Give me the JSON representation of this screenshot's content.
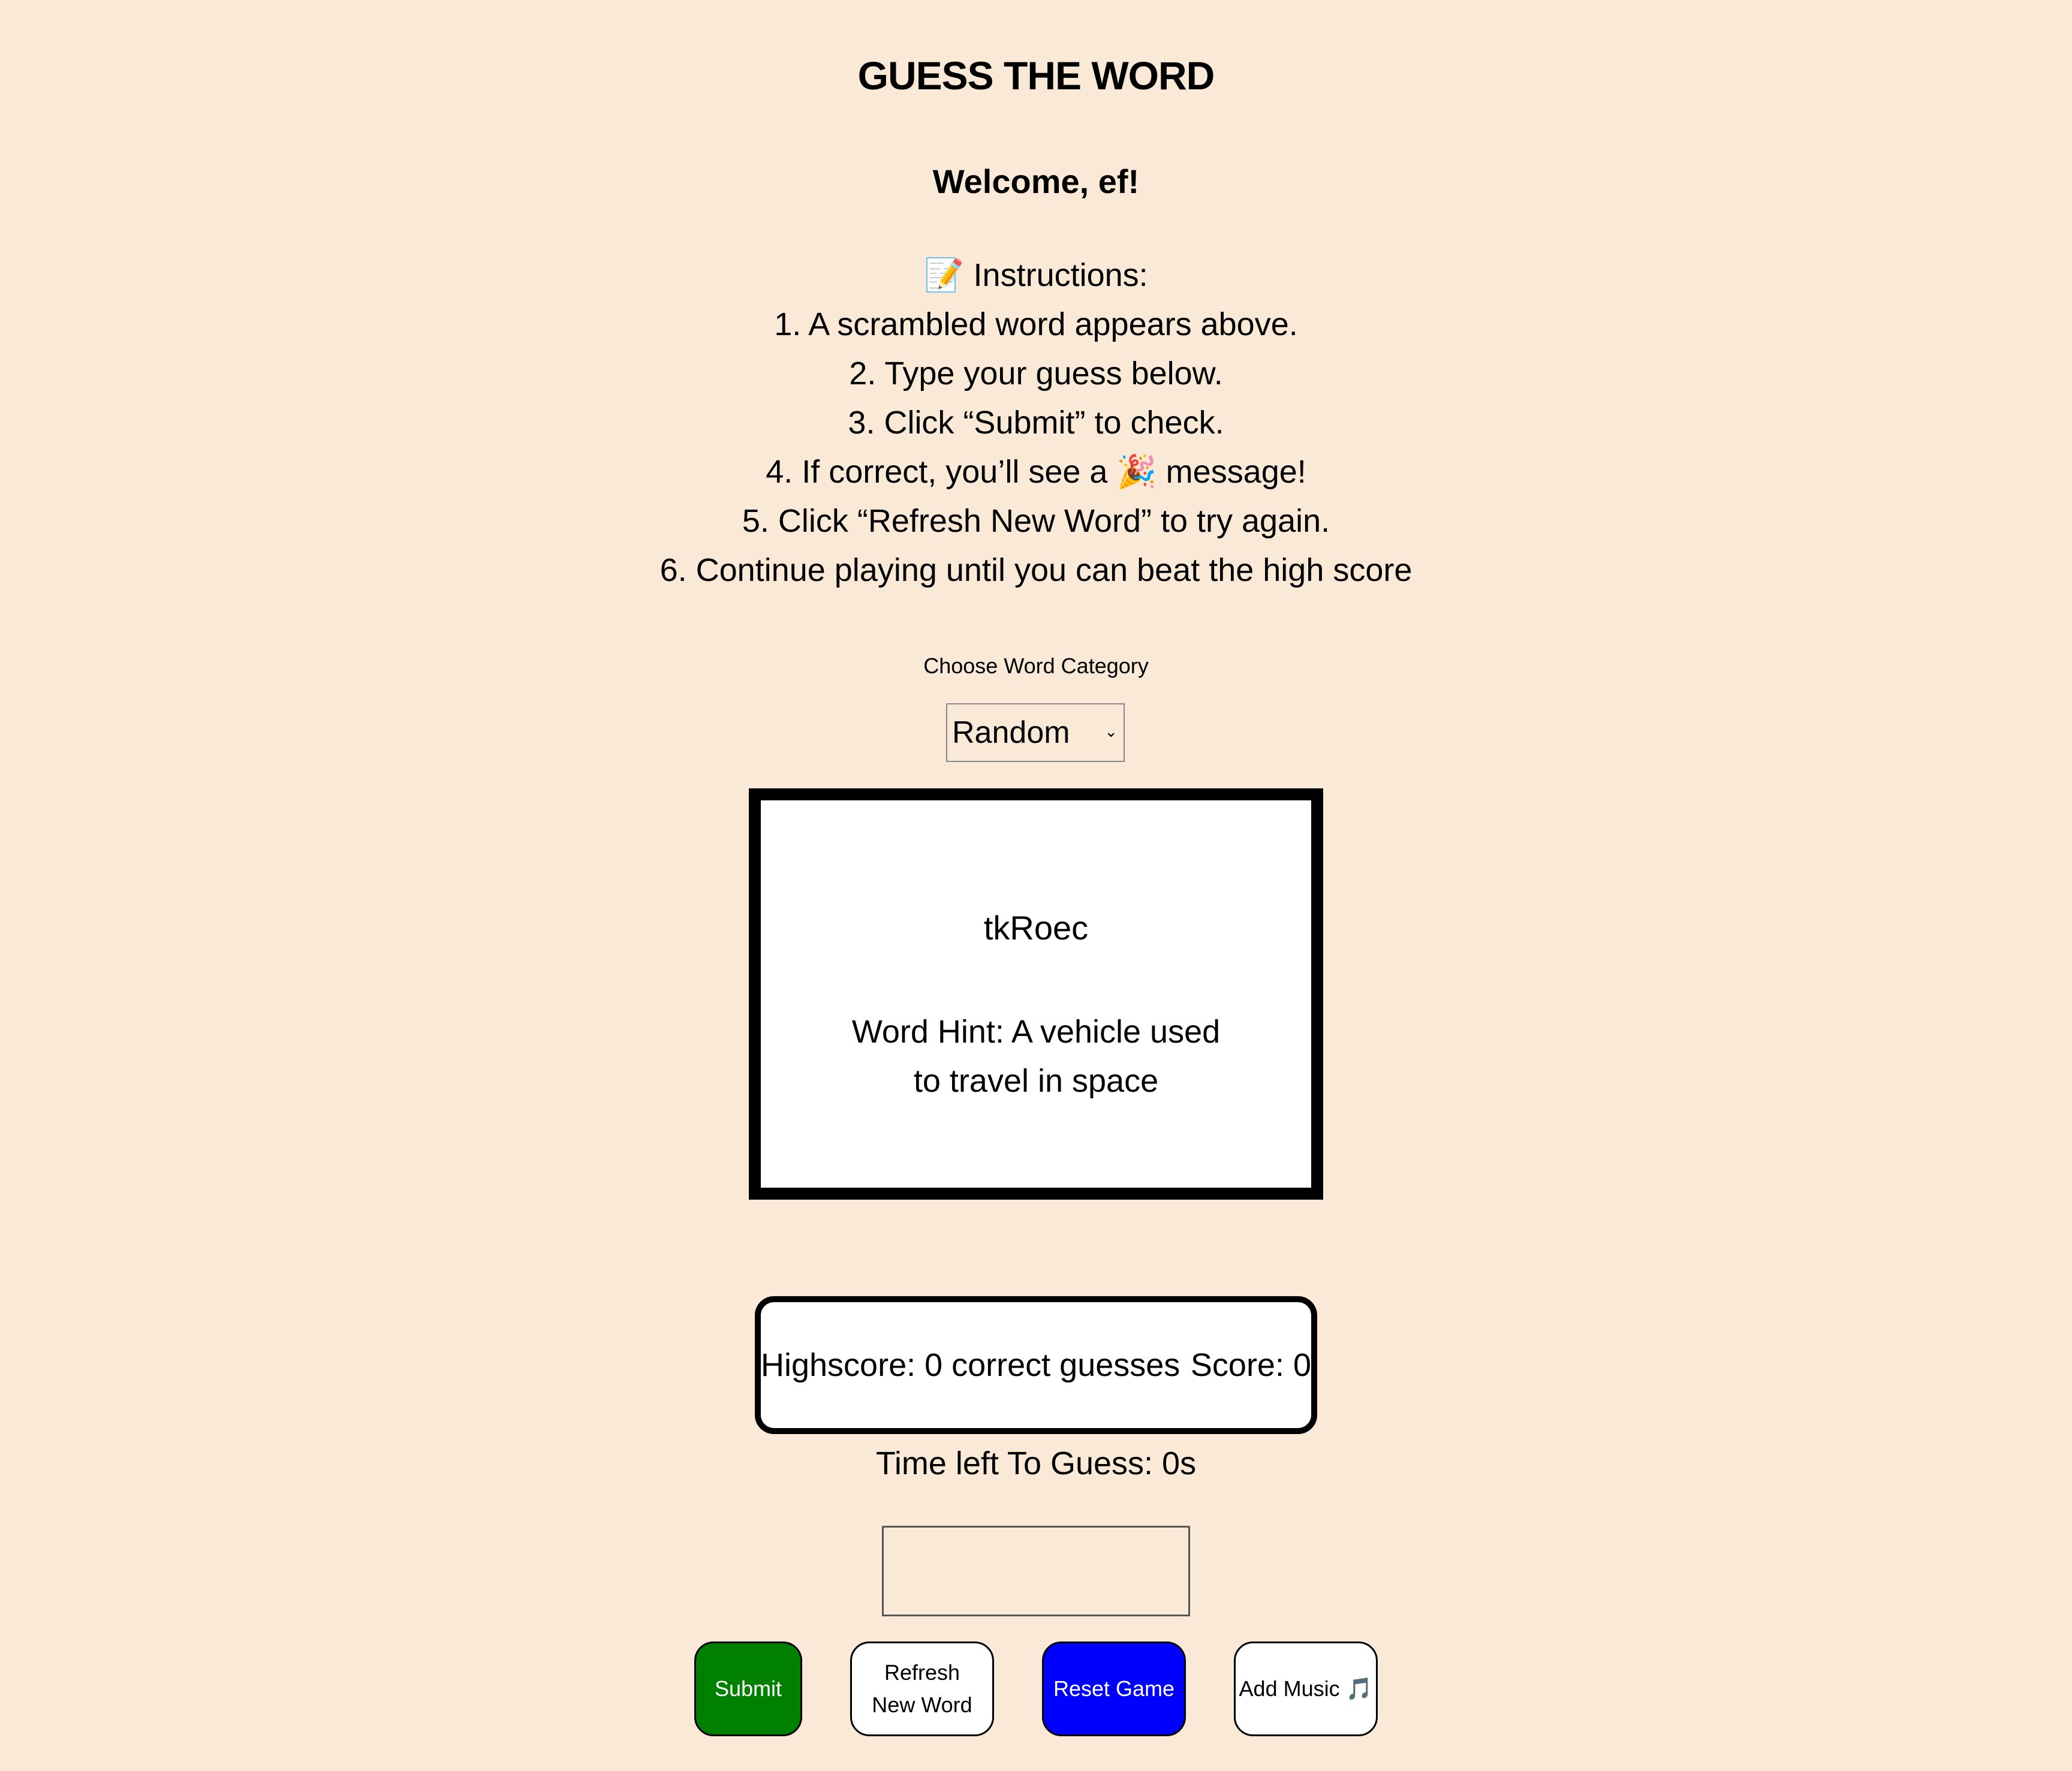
{
  "header": {
    "title": "GUESS THE WORD",
    "welcome": "Welcome, ef!"
  },
  "instructions": {
    "heading": "📝 Instructions:",
    "steps": [
      "1. A scrambled word appears above.",
      "2. Type your guess below.",
      "3. Click “Submit” to check.",
      "4. If correct, you’ll see a 🎉 message!",
      "5. Click “Refresh New Word” to try again.",
      "6. Continue playing until you can beat the high score"
    ]
  },
  "category": {
    "label": "Choose Word Category",
    "selected": "Random"
  },
  "word_card": {
    "scrambled_word": "tkRoec",
    "hint": "Word Hint: A vehicle used to travel in space"
  },
  "score": {
    "highscore_text": "Highscore: 0 correct guesses",
    "score_text": "Score: 0"
  },
  "timer": {
    "text": "Time left To Guess: 0s"
  },
  "guess": {
    "value": "",
    "placeholder": ""
  },
  "buttons": {
    "submit": "Submit",
    "refresh": "Refresh New Word",
    "reset": "Reset Game",
    "music": "Add Music 🎵"
  },
  "colors": {
    "background": "#f9e9d6",
    "submit": "#008000",
    "reset": "#0000ff"
  }
}
